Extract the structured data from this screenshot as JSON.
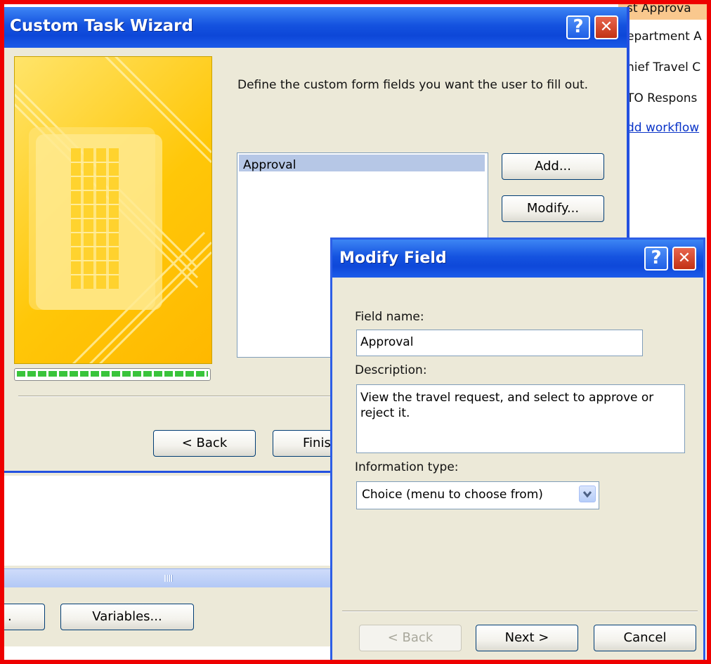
{
  "background_list": {
    "items": [
      "st Approva",
      "epartment A",
      "hief Travel C",
      "TO Respons"
    ],
    "link": "dd workflow"
  },
  "wizard": {
    "title": "Custom Task Wizard",
    "help_glyph": "?",
    "close_glyph": "✕",
    "instruction": "Define the custom form fields you want the user to fill out.",
    "fields": [
      "Approval"
    ],
    "add_label": "Add...",
    "modify_label": "Modify...",
    "back_label": "< Back",
    "finish_label": "Finis"
  },
  "lower_window": {
    "partial_button_label": ".",
    "variables_label": "Variables..."
  },
  "modify_field": {
    "title": "Modify Field",
    "help_glyph": "?",
    "close_glyph": "✕",
    "field_name_label": "Field name:",
    "field_name_value": "Approval",
    "description_label": "Description:",
    "description_value": "View the travel request, and select to approve or reject it.",
    "info_type_label": "Information type:",
    "info_type_value": "Choice (menu to choose from)",
    "back_label": "< Back",
    "next_label": "Next >",
    "cancel_label": "Cancel"
  },
  "colors": {
    "frame": "#ee0000",
    "title_bar": "#0d47d8",
    "dialog_face": "#ece9d8",
    "art": "#ffc708",
    "progress": "#39c43b"
  }
}
